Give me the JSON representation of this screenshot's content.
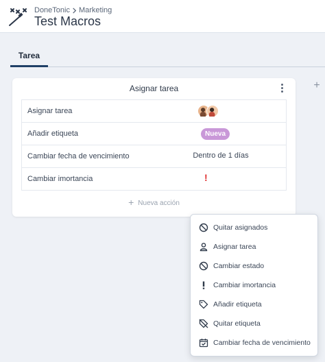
{
  "header": {
    "breadcrumb_root": "DoneTonic",
    "breadcrumb_child": "Marketing",
    "title": "Test Macros"
  },
  "tabs": [
    {
      "label": "Tarea",
      "active": true
    }
  ],
  "macro_card": {
    "title": "Asignar tarea",
    "actions": [
      {
        "label": "Asignar tarea",
        "value_type": "avatars"
      },
      {
        "label": "Añadir etiqueta",
        "value": "Nueva"
      },
      {
        "label": "Cambiar fecha de vencimiento",
        "value": "Dentro de  1 días"
      },
      {
        "label": "Cambiar imortancia",
        "value": "!"
      }
    ],
    "new_action_label": "Nueva acción"
  },
  "colors": {
    "tab_underline": "#1f3f66",
    "badge": "#c998d8",
    "importance": "#e03232"
  },
  "menu": {
    "items": [
      {
        "label": "Quitar asignados",
        "icon": "unassign-icon"
      },
      {
        "label": "Asignar tarea",
        "icon": "person-icon"
      },
      {
        "label": "Cambiar estado",
        "icon": "status-icon"
      },
      {
        "label": "Cambiar imortancia",
        "icon": "exclamation-icon"
      },
      {
        "label": "Añadir etiqueta",
        "icon": "tag-icon"
      },
      {
        "label": "Quitar etiqueta",
        "icon": "tag-off-icon"
      },
      {
        "label": "Cambiar fecha de vencimiento",
        "icon": "calendar-check-icon"
      }
    ]
  }
}
